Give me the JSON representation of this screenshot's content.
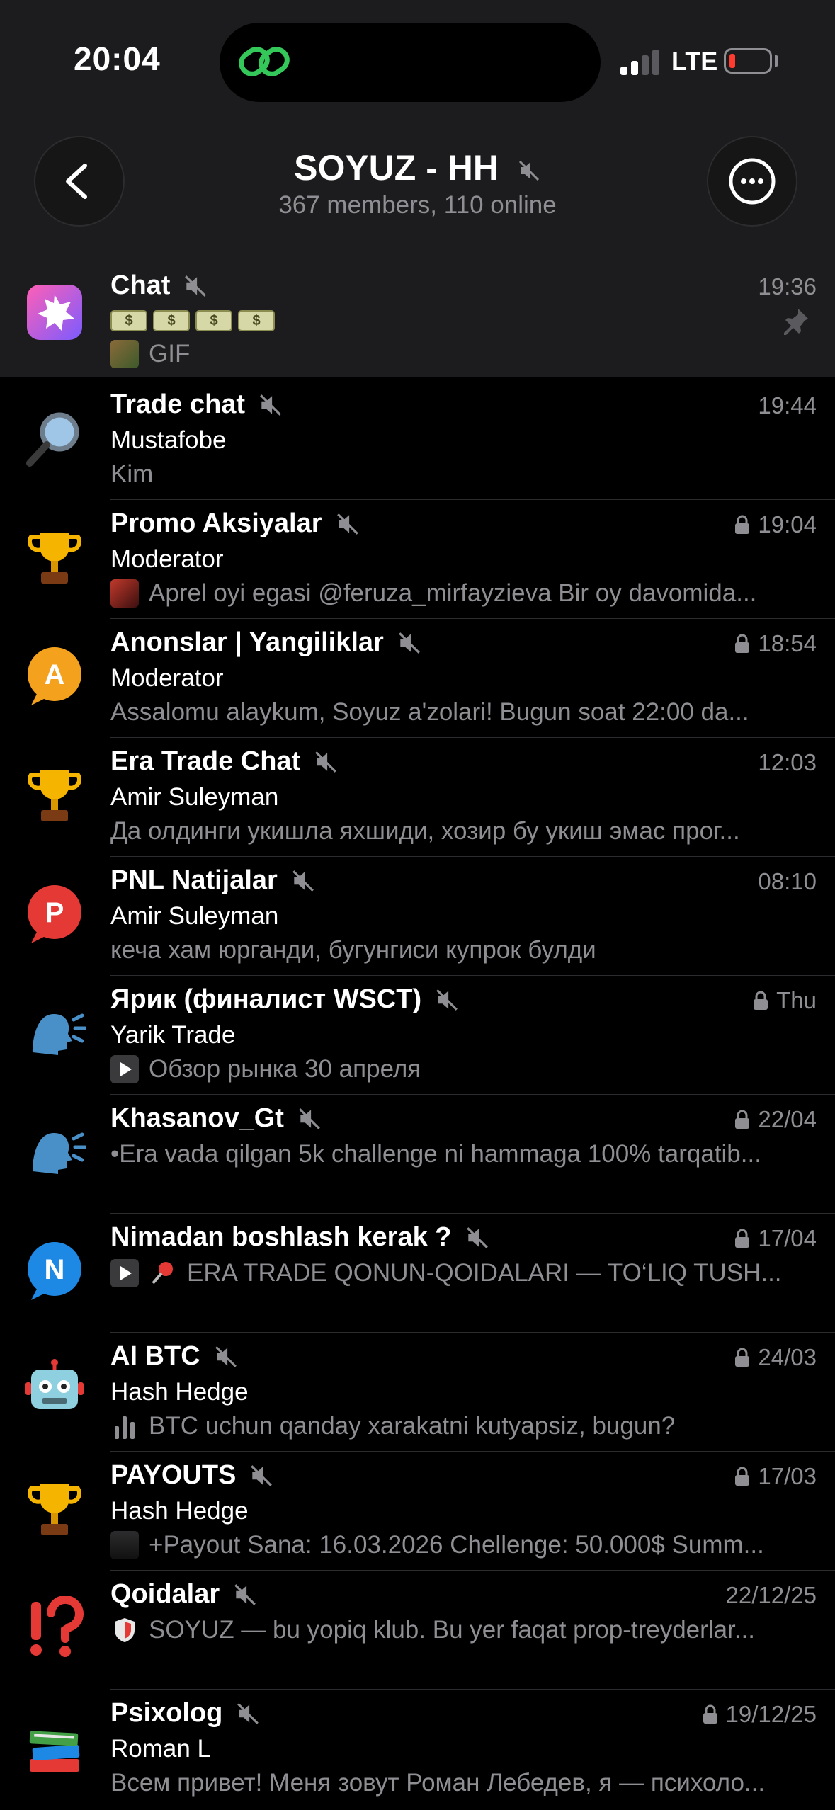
{
  "status": {
    "time": "20:04",
    "network": "LTE"
  },
  "header": {
    "title": "SOYUZ - HH",
    "subtitle": "367 members, 110 online"
  },
  "colors": {
    "background": "#000000",
    "panel": "#1c1c1e",
    "muted": "#8e8e93",
    "battery_low": "#ff3b30",
    "island_icon": "#34c759"
  },
  "chats": [
    {
      "name": "Chat",
      "time": "19:36",
      "sender": "",
      "preview": "GIF",
      "money_label": "$",
      "pinned": true,
      "locked": false,
      "avatar_icon": "burst-icon"
    },
    {
      "name": "Trade chat",
      "time": "19:44",
      "sender": "Mustafobe",
      "preview": "Kim",
      "locked": false,
      "avatar_icon": "magnifier-icon"
    },
    {
      "name": "Promo Aksiyalar",
      "time": "19:04",
      "sender": "Moderator",
      "preview": "Aprel oyi egasi @feruza_mirfayzieva Bir oy davomida...",
      "locked": true,
      "avatar_icon": "trophy-icon"
    },
    {
      "name": "Anonslar | Yangiliklar",
      "time": "18:54",
      "sender": "Moderator",
      "preview": "Assalomu alaykum, Soyuz a'zolari! Bugun soat 22:00 da...",
      "locked": true,
      "avatar_icon": "bubble-a-icon",
      "avatar_letter": "A"
    },
    {
      "name": "Era Trade Chat",
      "time": "12:03",
      "sender": "Amir Suleyman",
      "preview": "Да олдинги укишла яхшиди, хозир бу укиш эмас прог...",
      "locked": false,
      "avatar_icon": "trophy-icon"
    },
    {
      "name": "PNL Natijalar",
      "time": "08:10",
      "sender": "Amir Suleyman",
      "preview": "кеча хам юрганди, бугунгиси купрок булди",
      "locked": false,
      "avatar_icon": "bubble-p-icon",
      "avatar_letter": "P"
    },
    {
      "name": "Ярик (финалист WSCT)",
      "time": "Thu",
      "sender": "Yarik Trade",
      "preview": "Обзор рынка 30 апреля",
      "locked": true,
      "avatar_icon": "speaking-head-icon"
    },
    {
      "name": "Khasanov_Gt",
      "time": "22/04",
      "sender": "",
      "preview": "•Era vada qilgan 5k challenge ni hammaga 100% tarqatib...",
      "locked": true,
      "avatar_icon": "speaking-head-icon"
    },
    {
      "name": "Nimadan boshlash kerak ?",
      "time": "17/04",
      "sender": "",
      "preview": "ERA TRADE QONUN-QOIDALARI — TO‘LIQ TUSH...",
      "locked": true,
      "avatar_icon": "bubble-n-icon",
      "avatar_letter": "N"
    },
    {
      "name": "AI BTC",
      "time": "24/03",
      "sender": "Hash Hedge",
      "preview": "BTC uchun qanday xarakatni kutyapsiz, bugun?",
      "locked": true,
      "avatar_icon": "robot-icon"
    },
    {
      "name": "PAYOUTS",
      "time": "17/03",
      "sender": "Hash Hedge",
      "preview": "+Payout Sana: 16.03.2026 Chellenge: 50.000$ Summ...",
      "locked": true,
      "avatar_icon": "trophy-icon"
    },
    {
      "name": "Qoidalar",
      "time": "22/12/25",
      "sender": "",
      "preview": "SOYUZ — bu yopiq klub. Bu yer faqat prop-treyderlar...",
      "locked": false,
      "avatar_icon": "exclamation-question-icon"
    },
    {
      "name": "Psixolog",
      "time": "19/12/25",
      "sender": "Roman L",
      "preview": "Всем привет! Меня зовут Роман Лебедев, я — психоло...",
      "locked": true,
      "avatar_icon": "books-icon"
    }
  ]
}
